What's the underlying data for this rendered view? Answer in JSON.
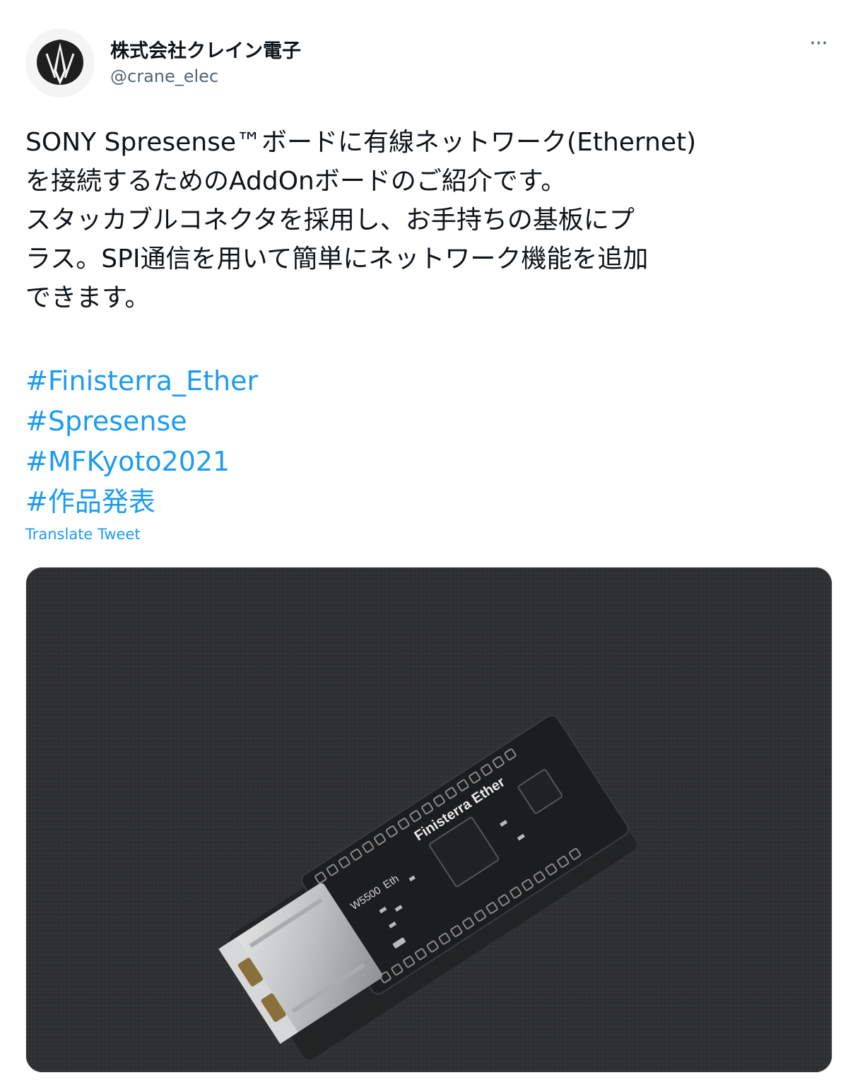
{
  "account": {
    "display_name": "株式会社クレイン電子",
    "handle": "@crane_elec",
    "avatar_icon": "crane-logo-icon"
  },
  "tweet": {
    "more_icon": "more-dots-icon",
    "more_label": "···",
    "text_lines": [
      "SONY Spresense™ボードに有線ネットワーク(Ethernet)",
      "を接続するためのAddOnボードのご紹介です。",
      "スタッカブルコネクタを採用し、お手持ちの基板にプ",
      "ラス。SPI通信を用いて簡単にネットワーク機能を追加",
      "できます。"
    ],
    "hashtags": [
      "#Finisterra_Ether",
      "#Spresense",
      "#MFKyoto2021",
      "#作品発表"
    ],
    "translate_label": "Translate Tweet"
  },
  "media": {
    "board_silkscreen": "Finisterra Ether",
    "chip_label": "W5500",
    "board_model": "Eth"
  },
  "colors": {
    "link": "#1d9bf0",
    "text": "#0f1419",
    "secondary": "#536471",
    "photo_background": "#2f3032",
    "pcb": "#1c1d1f"
  }
}
